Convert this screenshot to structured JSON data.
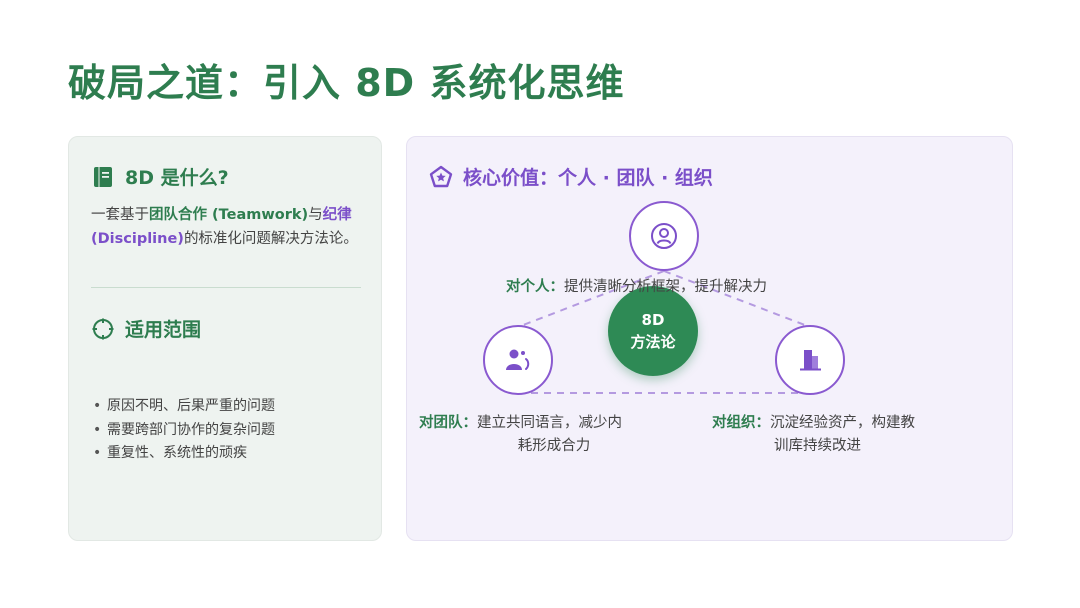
{
  "title": "破局之道：引入 8D 系统化思维",
  "left": {
    "what_heading": "8D 是什么?",
    "desc_pre": "一套基于",
    "desc_hl1": "团队合作 (Teamwork)",
    "desc_mid": "与",
    "desc_hl2": "纪律 (Discipline)",
    "desc_post": "的标准化问题解决方法论。",
    "scope_heading": "适用范围",
    "bullets": [
      "原因不明、后果严重的问题",
      "需要跨部门协作的复杂问题",
      "重复性、系统性的顽疾"
    ]
  },
  "right": {
    "heading": "核心价值：个人 · 团队 · 组织",
    "center_line1": "8D",
    "center_line2": "方法论",
    "personal_key": "对个人：",
    "personal_text": "提供清晰分析框架，提升解决力",
    "team_key": "对团队：",
    "team_text_1": "建立共同语言，减少内",
    "team_text_2": "耗形成合力",
    "org_key": "对组织：",
    "org_text_1": "沉淀经验资产，构建教",
    "org_text_2": "训库持续改进"
  },
  "colors": {
    "green": "#2e7d4f",
    "purple": "#7b4fc9"
  },
  "icons": {
    "what": "book-icon",
    "scope": "target-icon",
    "value": "pentagon-star-icon",
    "personal": "person-icon",
    "team": "team-icon",
    "org": "building-icon"
  }
}
